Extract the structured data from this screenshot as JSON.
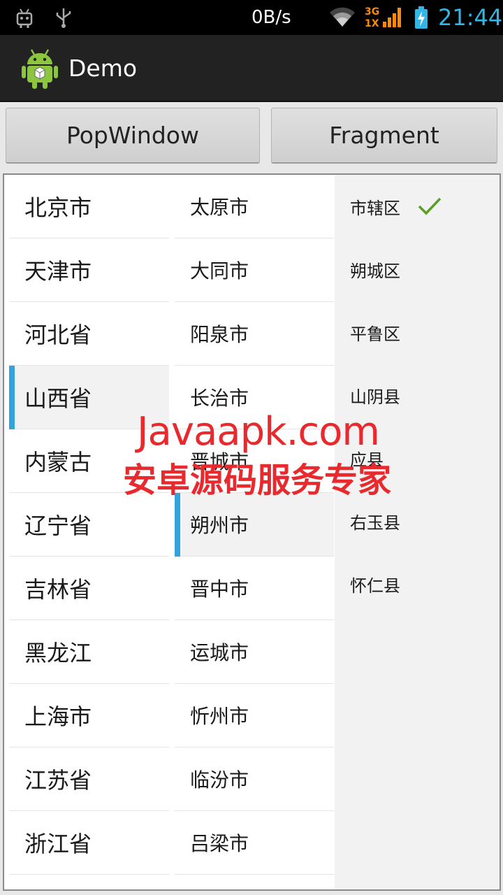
{
  "status_bar": {
    "net_speed": "0B/s",
    "network_label_top": "3G",
    "network_label_bottom": "1X",
    "time": "21:44",
    "icons": [
      "android-debug-icon",
      "usb-icon",
      "wifi-icon",
      "signal-icon",
      "battery-charging-icon"
    ]
  },
  "action_bar": {
    "title": "Demo",
    "icon": "android-app-icon"
  },
  "buttons": {
    "popwindow_label": "PopWindow",
    "fragment_label": "Fragment"
  },
  "provinces": [
    "北京市",
    "天津市",
    "河北省",
    "山西省",
    "内蒙古",
    "辽宁省",
    "吉林省",
    "黑龙江",
    "上海市",
    "江苏省",
    "浙江省"
  ],
  "selected_province": "山西省",
  "cities": [
    "太原市",
    "大同市",
    "阳泉市",
    "长治市",
    "晋城市",
    "朔州市",
    "晋中市",
    "运城市",
    "忻州市",
    "临汾市",
    "吕梁市"
  ],
  "selected_city": "朔州市",
  "districts": [
    "市辖区",
    "朔城区",
    "平鲁区",
    "山阴县",
    "应县",
    "右玉县",
    "怀仁县"
  ],
  "selected_district": "市辖区",
  "watermark": {
    "line1": "Javaapk.com",
    "line2": "安卓源码服务专家"
  },
  "colors": {
    "accent": "#33a3dc",
    "clock": "#33b5e5",
    "check": "#5a9e22",
    "watermark": "#e8292e"
  }
}
